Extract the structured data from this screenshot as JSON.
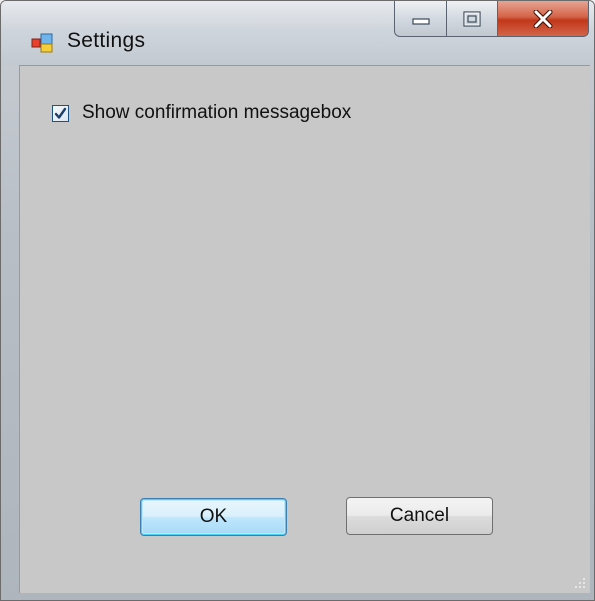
{
  "window": {
    "title": "Settings"
  },
  "caption_buttons": {
    "minimize_icon": "minimize-icon",
    "maximize_icon": "maximize-icon",
    "close_icon": "close-icon"
  },
  "options": {
    "show_confirmation": {
      "label": "Show confirmation messagebox",
      "checked": true
    }
  },
  "buttons": {
    "ok_label": "OK",
    "cancel_label": "Cancel"
  },
  "colors": {
    "client_bg": "#c8c8c8",
    "close_button": "#c2371a",
    "default_button_focus": "#48d0f7"
  }
}
